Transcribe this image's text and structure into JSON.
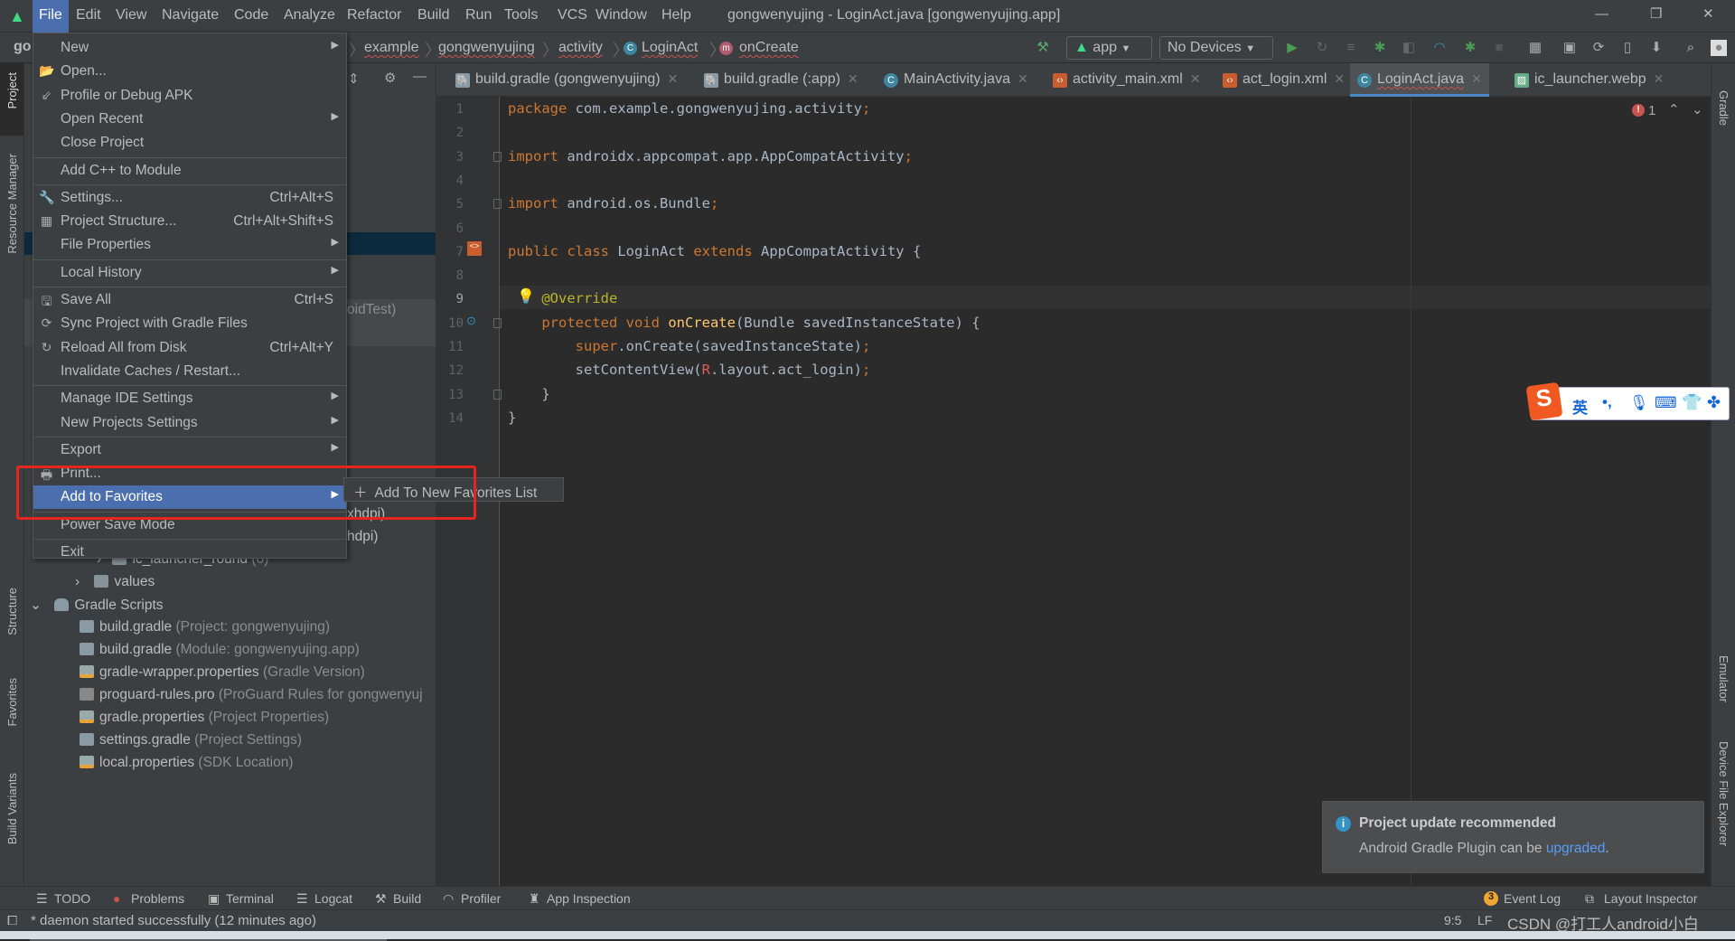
{
  "menubar": {
    "items": [
      "File",
      "Edit",
      "View",
      "Navigate",
      "Code",
      "Analyze",
      "Refactor",
      "Build",
      "Run",
      "Tools",
      "VCS",
      "Window",
      "Help"
    ],
    "window_title": "gongwenyujing - LoginAct.java [gongwenyujing.app]",
    "controls": {
      "minimize": "—",
      "restore": "❐",
      "close": "✕"
    }
  },
  "navbar": {
    "project_short": "go",
    "breadcrumbs": [
      "example",
      "gongwenyujing",
      "activity",
      "LoginAct",
      "onCreate"
    ],
    "run_config": "app",
    "device": "No Devices"
  },
  "left_tools": [
    "Project",
    "Resource Manager",
    "Structure",
    "Favorites",
    "Build Variants"
  ],
  "right_tools": [
    "Gradle",
    "Emulator",
    "Device File Explorer"
  ],
  "tabs": [
    {
      "label": "build.gradle (gongwenyujing)",
      "icon": "gradle-icon"
    },
    {
      "label": "build.gradle (:app)",
      "icon": "gradle-icon"
    },
    {
      "label": "MainActivity.java",
      "icon": "class-icon"
    },
    {
      "label": "activity_main.xml",
      "icon": "xml-icon"
    },
    {
      "label": "act_login.xml",
      "icon": "xml-icon"
    },
    {
      "label": "LoginAct.java",
      "icon": "class-icon",
      "active": true
    },
    {
      "label": "ic_launcher.webp",
      "icon": "image-icon"
    }
  ],
  "editor": {
    "error_count": "1",
    "code": [
      [
        [
          "kw",
          "package "
        ],
        [
          "tx",
          "com.example.gongwenyujing.activity"
        ],
        [
          "kw",
          ";"
        ]
      ],
      [],
      [
        [
          "kw",
          "import "
        ],
        [
          "tx",
          "androidx.appcompat.app.AppCompatActivity"
        ],
        [
          "kw",
          ";"
        ]
      ],
      [],
      [
        [
          "kw",
          "import "
        ],
        [
          "tx",
          "android.os.Bundle"
        ],
        [
          "kw",
          ";"
        ]
      ],
      [],
      [
        [
          "kw",
          "public class "
        ],
        [
          "tx",
          "LoginAct "
        ],
        [
          "kw",
          "extends "
        ],
        [
          "tx",
          "AppCompatActivity {"
        ]
      ],
      [],
      [
        [
          "an",
          "    @Override"
        ]
      ],
      [
        [
          "kw",
          "    protected void "
        ],
        [
          "fn",
          "onCreate"
        ],
        [
          "tx",
          "(Bundle savedInstanceState) {"
        ]
      ],
      [
        [
          "kw",
          "        super"
        ],
        [
          "tx",
          ".onCreate(savedInstanceState)"
        ],
        [
          "kw",
          ";"
        ]
      ],
      [
        [
          "tx",
          "        setContentView("
        ],
        [
          "rr",
          "R"
        ],
        [
          "tx",
          ".layout.act_login)"
        ],
        [
          "kw",
          ";"
        ]
      ],
      [
        [
          "tx",
          "    }"
        ]
      ],
      [
        [
          "tx",
          "}"
        ]
      ]
    ]
  },
  "project_tree": {
    "partial": [
      "oidTest)",
      "xhdpi)",
      "hdpi)"
    ],
    "ic_launcher_round": {
      "label": "ic_launcher_round",
      "hint": "(6)"
    },
    "values": "values",
    "gradle_scripts": "Gradle Scripts",
    "items": [
      {
        "label": "build.gradle",
        "hint": "(Project: gongwenyujing)",
        "icon": "gradle-icon"
      },
      {
        "label": "build.gradle",
        "hint": "(Module: gongwenyujing.app)",
        "icon": "gradle-icon"
      },
      {
        "label": "gradle-wrapper.properties",
        "hint": "(Gradle Version)",
        "icon": "properties-icon"
      },
      {
        "label": "proguard-rules.pro",
        "hint": "(ProGuard Rules for gongwenyuj",
        "icon": "file-icon"
      },
      {
        "label": "gradle.properties",
        "hint": "(Project Properties)",
        "icon": "properties-icon"
      },
      {
        "label": "settings.gradle",
        "hint": "(Project Settings)",
        "icon": "gradle-icon"
      },
      {
        "label": "local.properties",
        "hint": "(SDK Location)",
        "icon": "properties-icon"
      }
    ]
  },
  "file_menu": [
    {
      "label": "New",
      "submenu": true
    },
    {
      "label": "Open...",
      "icon": "folder-open-icon",
      "glyph": "📂"
    },
    {
      "label": "Profile or Debug APK",
      "icon": "profile-apk-icon",
      "glyph": "⇙"
    },
    {
      "label": "Open Recent",
      "submenu": true
    },
    {
      "label": "Close Project"
    },
    {
      "sep": true
    },
    {
      "label": "Add C++ to Module"
    },
    {
      "sep": true
    },
    {
      "label": "Settings...",
      "shortcut": "Ctrl+Alt+S",
      "icon": "wrench-icon",
      "glyph": "🔧"
    },
    {
      "label": "Project Structure...",
      "shortcut": "Ctrl+Alt+Shift+S",
      "icon": "project-structure-icon",
      "glyph": "▦"
    },
    {
      "label": "File Properties",
      "submenu": true
    },
    {
      "sep": true
    },
    {
      "label": "Local History",
      "submenu": true
    },
    {
      "sep": true
    },
    {
      "label": "Save All",
      "shortcut": "Ctrl+S",
      "icon": "save-icon",
      "glyph": "🖫"
    },
    {
      "label": "Sync Project with Gradle Files",
      "icon": "gradle-sync-icon",
      "glyph": "⟳"
    },
    {
      "label": "Reload All from Disk",
      "shortcut": "Ctrl+Alt+Y",
      "icon": "reload-icon",
      "glyph": "↻"
    },
    {
      "label": "Invalidate Caches / Restart..."
    },
    {
      "sep": true
    },
    {
      "label": "Manage IDE Settings",
      "submenu": true
    },
    {
      "label": "New Projects Settings",
      "submenu": true
    },
    {
      "sep": true
    },
    {
      "label": "Export",
      "submenu": true
    },
    {
      "label": "Print...",
      "icon": "print-icon",
      "glyph": "🖶"
    },
    {
      "label": "Add to Favorites",
      "submenu": true,
      "highlighted": true
    },
    {
      "sep": true
    },
    {
      "label": "Power Save Mode"
    },
    {
      "sep": true
    },
    {
      "label": "Exit"
    }
  ],
  "submenu": {
    "label": "Add To New Favorites List",
    "icon": "plus-icon"
  },
  "bottom_tools": [
    "TODO",
    "Problems",
    "Terminal",
    "Logcat",
    "Build",
    "Profiler",
    "App Inspection"
  ],
  "bottom_right": {
    "event_log": "Event Log",
    "event_count": "3",
    "layout_inspector": "Layout Inspector"
  },
  "status": {
    "message": "* daemon started successfully (12 minutes ago)",
    "position": "9:5",
    "line_sep": "LF",
    "watermark": "CSDN @打工人android小白"
  },
  "notification": {
    "title": "Project update recommended",
    "body": "Android Gradle Plugin can be ",
    "link": "upgraded",
    "end": "."
  },
  "ime": {
    "lang": "英",
    "punct": "•,"
  },
  "colors": {
    "accent": "#4b6eaf",
    "keyword": "#cc7832",
    "annotation": "#bbb529",
    "method": "#ffc66d",
    "highlight_box": "#e8251c",
    "link": "#589df6"
  }
}
